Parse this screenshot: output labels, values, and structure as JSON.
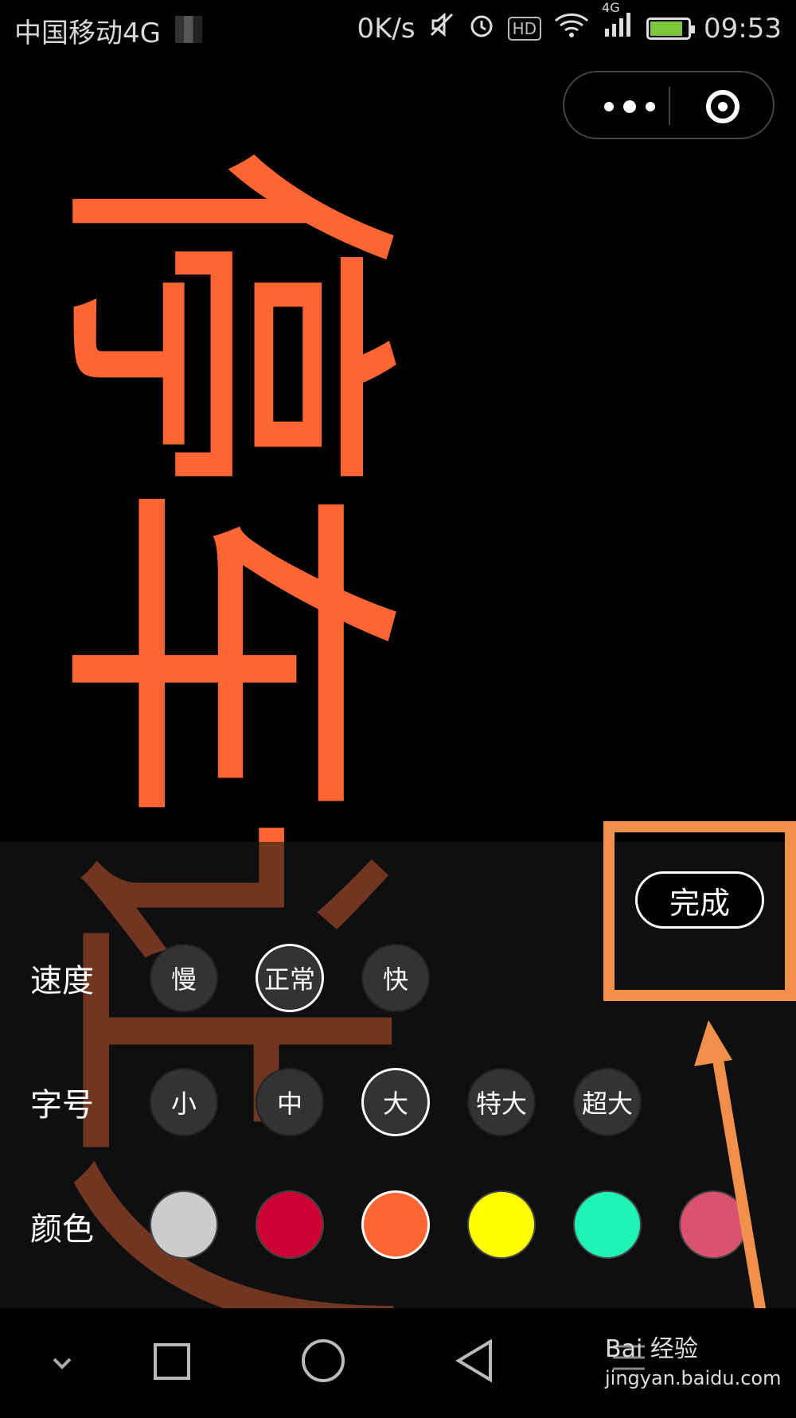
{
  "status_bar": {
    "carrier": "中国移动4G",
    "net_speed": "0K/s",
    "hd_badge": "HD",
    "signal_badge": "4G",
    "time": "09:53"
  },
  "marquee": {
    "text": "停车让人",
    "color": "#ff6633"
  },
  "done_label": "完成",
  "speed": {
    "label": "速度",
    "options": [
      "慢",
      "正常",
      "快"
    ],
    "selected": "正常"
  },
  "size": {
    "label": "字号",
    "options": [
      "小",
      "中",
      "大",
      "特大",
      "超大"
    ],
    "selected": "大"
  },
  "color": {
    "label": "颜色",
    "swatches": [
      "#cccccc",
      "#cc0033",
      "#ff6633",
      "#ffff00",
      "#1ef5b4",
      "#d9536e"
    ],
    "selected": "#ff6633"
  },
  "annotation_color": "#f0904a",
  "watermark": {
    "brand": "Bai 经验",
    "url": "jingyan.baidu.com"
  }
}
